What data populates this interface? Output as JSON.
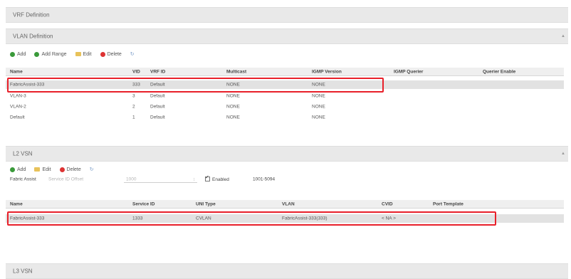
{
  "vrf_definition": {
    "title": "VRF Definition"
  },
  "vlan_definition": {
    "title": "VLAN Definition",
    "toolbar": {
      "add": "Add",
      "add_range": "Add Range",
      "edit": "Edit",
      "delete": "Delete"
    },
    "columns": [
      "Name",
      "VID",
      "VRF ID",
      "Multicast",
      "IGMP Version",
      "IGMP Querier",
      "Querier Enable"
    ],
    "rows": [
      [
        "FabricAssist-333",
        "333",
        "Default",
        "NONE",
        "NONE",
        "",
        ""
      ],
      [
        "VLAN-3",
        "3",
        "Default",
        "NONE",
        "NONE",
        "",
        ""
      ],
      [
        "VLAN-2",
        "2",
        "Default",
        "NONE",
        "NONE",
        "",
        ""
      ],
      [
        "Default",
        "1",
        "Default",
        "NONE",
        "NONE",
        "",
        ""
      ]
    ]
  },
  "l2_vsn": {
    "title": "L2 VSN",
    "toolbar": {
      "add": "Add",
      "edit": "Edit",
      "delete": "Delete"
    },
    "fabric_assist": {
      "label": "Fabric Assist",
      "offset_label": "Service ID Offset",
      "offset_value": "1000",
      "enabled_label": "Enabled",
      "range": "1001-5094"
    },
    "columns": [
      "Name",
      "Service ID",
      "UNI Type",
      "VLAN",
      "CVID",
      "Port Template"
    ],
    "rows": [
      [
        "FabricAssist-333",
        "1333",
        "CVLAN",
        "FabricAssist-333(333)",
        "< NA >",
        ""
      ]
    ]
  },
  "l3_vsn": {
    "title": "L3 VSN"
  }
}
